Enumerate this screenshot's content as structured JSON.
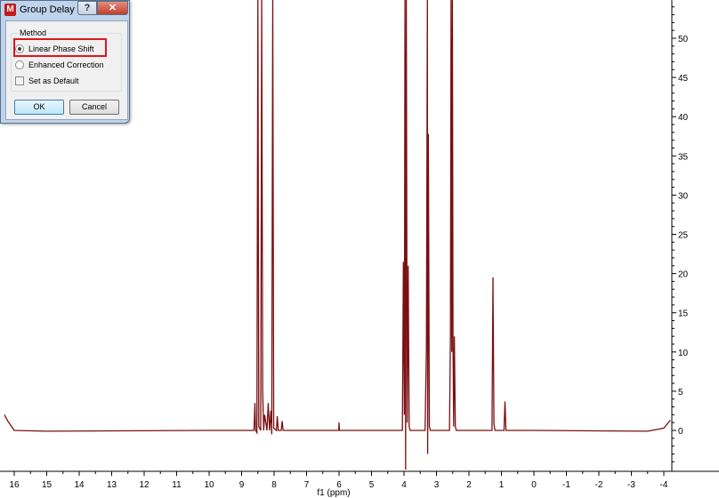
{
  "dialog": {
    "title": "Group Delay",
    "help_glyph": "?",
    "close_glyph": "✕",
    "app_icon_letter": "M",
    "group_label": "Method",
    "options": [
      {
        "label": "Linear Phase Shift",
        "selected": true
      },
      {
        "label": "Enhanced Correction",
        "selected": false
      }
    ],
    "checkbox": {
      "label": "Set as Default",
      "checked": false
    },
    "ok_label": "OK",
    "cancel_label": "Cancel"
  },
  "chart_data": {
    "type": "line",
    "xlabel": "f1 (ppm)",
    "x_ticks": [
      "16",
      "15",
      "14",
      "13",
      "12",
      "11",
      "10",
      "9",
      "8",
      "7",
      "6",
      "5",
      "4",
      "3",
      "2",
      "1",
      "0",
      "-1",
      "-2",
      "-3",
      "-4"
    ],
    "y_ticks": [
      "50",
      "45",
      "40",
      "35",
      "30",
      "25",
      "20",
      "15",
      "10",
      "5",
      "0"
    ],
    "xlim": [
      16.3,
      -4.2
    ],
    "ylim": [
      -5,
      55
    ],
    "color": "#7a1012",
    "x": [
      16.3,
      16.2,
      16.0,
      15.0,
      10.0,
      8.62,
      8.59,
      8.57,
      8.53,
      8.5,
      8.47,
      8.41,
      8.38,
      8.35,
      8.32,
      8.29,
      8.22,
      8.18,
      8.14,
      8.1,
      8.07,
      8.04,
      8.01,
      7.93,
      7.9,
      7.87,
      7.78,
      7.75,
      7.72,
      6.01,
      6.0,
      5.99,
      5.0,
      4.05,
      4.02,
      3.99,
      3.97,
      3.95,
      3.93,
      3.9,
      3.87,
      3.84,
      3.81,
      3.35,
      3.31,
      3.28,
      3.27,
      3.25,
      3.22,
      3.19,
      2.6,
      2.57,
      2.55,
      2.53,
      2.51,
      2.49,
      2.47,
      2.45,
      2.42,
      2.39,
      1.5,
      1.29,
      1.26,
      1.23,
      1.2,
      0.92,
      0.89,
      0.86,
      0.0,
      -3.5,
      -4.0,
      -4.2
    ],
    "y": [
      2.0,
      1.2,
      0.0,
      -0.1,
      0.0,
      0.0,
      3.5,
      0.0,
      -0.3,
      60.0,
      0.5,
      0.0,
      60.0,
      5.0,
      0.0,
      2.0,
      0.0,
      3.5,
      0.0,
      2.5,
      -0.5,
      60.0,
      0.3,
      0.0,
      1.8,
      0.0,
      0.0,
      1.2,
      0.0,
      0.0,
      1.0,
      0.0,
      0.0,
      0.0,
      21.5,
      2.0,
      60.0,
      -5.0,
      60.0,
      1.0,
      21.0,
      0.5,
      0.0,
      0.0,
      10.5,
      60.0,
      -3.0,
      37.8,
      0.5,
      0.0,
      0.0,
      12.0,
      60.0,
      10.0,
      60.0,
      11.0,
      0.5,
      12.0,
      0.5,
      0.0,
      0.0,
      0.0,
      19.5,
      0.8,
      0.0,
      0.0,
      3.7,
      0.0,
      0.0,
      -0.1,
      0.3,
      1.3
    ]
  }
}
